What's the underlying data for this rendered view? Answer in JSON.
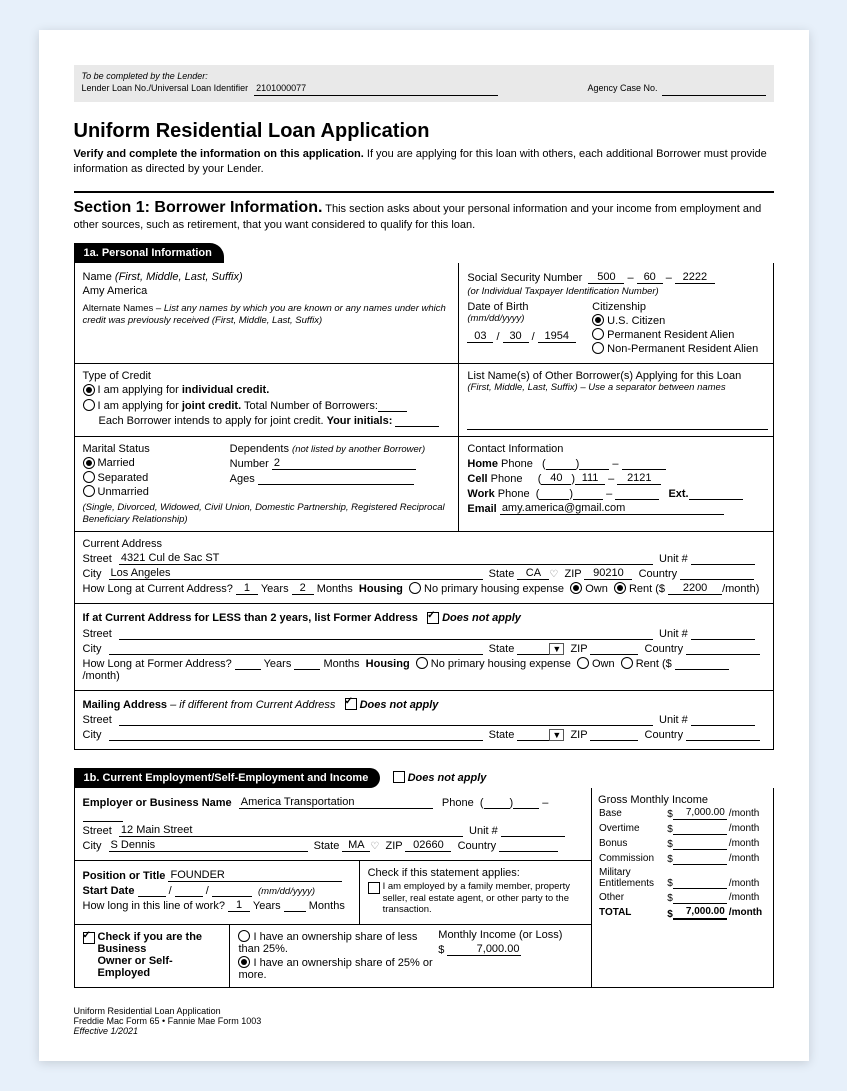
{
  "lender": {
    "completedBy": "To be completed by the Lender:",
    "label": "Lender Loan No./Universal Loan Identifier",
    "value": "2101000077",
    "agencyLabel": "Agency Case No.",
    "agencyValue": ""
  },
  "title": "Uniform Residential Loan Application",
  "introBold": "Verify and complete the information on this application.",
  "introRest": " If you are applying for this loan with others, each additional Borrower must provide information as directed by your Lender.",
  "section": {
    "head": "Section 1: Borrower Information.",
    "desc": " This section asks about your personal information and your income from employment and other sources, such as retirement, that you want considered to qualify for this loan."
  },
  "s1a": {
    "tab": "1a. Personal Information",
    "nameLabel": "Name",
    "nameHint": "(First, Middle, Last, Suffix)",
    "name": "Amy America",
    "altLabel": "Alternate Names",
    "altHint": "– List any names by which you are known or any names under which credit was previously received  (First, Middle, Last, Suffix)",
    "ssnLabel": "Social Security Number",
    "ssn1": "500",
    "ssn2": "60",
    "ssn3": "2222",
    "ssnHint": "(or Individual Taxpayer Identification Number)",
    "dobLabel": "Date of Birth",
    "dobHint": "(mm/dd/yyyy)",
    "dobM": "03",
    "dobD": "30",
    "dobY": "1954",
    "citizenLabel": "Citizenship",
    "citizen1": "U.S. Citizen",
    "citizen2": "Permanent Resident Alien",
    "citizen3": "Non-Permanent Resident Alien",
    "creditLabel": "Type of Credit",
    "credit1a": "I am applying for ",
    "credit1b": "individual credit.",
    "credit2a": "I am applying for ",
    "credit2b": "joint credit.",
    "credit2c": "  Total Number of Borrowers:",
    "credit3": "Each Borrower intends to apply for joint credit. ",
    "credit3b": "Your initials:",
    "otherLabel": "List Name(s) of Other Borrower(s) Applying for this Loan",
    "otherHint": "(First, Middle, Last, Suffix) – Use a separator between names",
    "maritalLabel": "Marital Status",
    "m1": "Married",
    "m2": "Separated",
    "m3": "Unmarried",
    "mHint": "(Single, Divorced, Widowed, Civil Union, Domestic Partnership, Registered Reciprocal Beneficiary Relationship)",
    "depLabel": "Dependents",
    "depHint": "(not listed by another Borrower)",
    "depNumLabel": "Number",
    "depNum": "2",
    "depAgesLabel": "Ages",
    "contactLabel": "Contact Information",
    "homePhone": "Home",
    "cellPhone": "Cell",
    "workPhone": "Work",
    "phoneWord": "Phone",
    "extLabel": "Ext.",
    "cell1": "40",
    "cell2": "111",
    "cell3": "2121",
    "emailLabel": "Email",
    "email": "amy.america@gmail.com",
    "curAddrLabel": "Current Address",
    "streetLabel": "Street",
    "street": "4321 Cul de Sac ST",
    "unitLabel": "Unit #",
    "cityLabel": "City",
    "city": "Los Angeles",
    "stateLabel": "State",
    "state": "CA",
    "zipLabel": "ZIP",
    "zip": "90210",
    "countryLabel": "Country",
    "howLongLabel": "How Long at Current Address?",
    "years": "1",
    "yearsLabel": "Years",
    "months": "2",
    "monthsLabel": "Months",
    "housingLabel": "Housing",
    "housing1": "No primary housing expense",
    "housing2": "Own",
    "housing3": "Rent ($",
    "rent": "2200",
    "perMonth": "/month)",
    "formerHead": "If at Current Address for LESS than 2 years, list Former Address",
    "dna": "Does not apply",
    "formerHowLong": "How Long at Former Address?",
    "mailHead": "Mailing Address",
    "mailHint": "– if different from Current Address"
  },
  "s1b": {
    "tab": "1b. Current Employment/Self-Employment and Income",
    "dna": "Does not apply",
    "empLabel": "Employer or Business Name",
    "emp": "America Transportation",
    "phoneLabel": "Phone",
    "streetLabel": "Street",
    "street": "12 Main Street",
    "unitLabel": "Unit #",
    "cityLabel": "City",
    "city": "S Dennis",
    "stateLabel": "State",
    "state": "MA",
    "zipLabel": "ZIP",
    "zip": "02660",
    "countryLabel": "Country",
    "posLabel": "Position or Title",
    "pos": "FOUNDER",
    "startLabel": "Start Date",
    "startHint": "(mm/dd/yyyy)",
    "lineWorkLabel": "How long in this line of work?",
    "lwYears": "1",
    "yearsLabel": "Years",
    "monthsLabel": "Months",
    "stmtLabel": "Check if this statement applies:",
    "stmtText": "I am employed by a family member, property seller, real estate agent, or other party to the transaction.",
    "ownerLabel1": "Check if you are the Business",
    "ownerLabel2": "Owner or Self-Employed",
    "share1": "I have an ownership share of less than 25%.",
    "share2": "I have an ownership share of 25% or more.",
    "monthlyLabel": "Monthly Income (or Loss)",
    "monthlyVal": "7,000.00",
    "grossLabel": "Gross Monthly Income",
    "gBase": "Base",
    "gBaseVal": "7,000.00",
    "gOT": "Overtime",
    "gBonus": "Bonus",
    "gComm": "Commission",
    "gMil1": "Military",
    "gMil2": "Entitlements",
    "gOther": "Other",
    "gTotal": "TOTAL",
    "gTotalVal": "7,000.00",
    "perMonth": "/month",
    "dollar": "$"
  },
  "footer": {
    "l1": "Uniform Residential Loan Application",
    "l2": "Freddie Mac Form 65  •  Fannie Mae Form 1003",
    "l3": "Effective 1/2021"
  }
}
